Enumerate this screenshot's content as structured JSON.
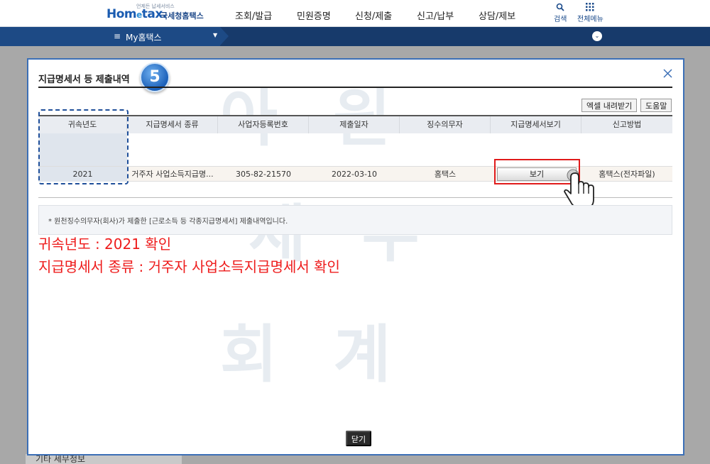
{
  "header": {
    "logo_tag": "언제든 납세서비스",
    "logo_text_home": "Hom",
    "logo_text_e": "e",
    "logo_text_tax": "tax.",
    "logo_org": "국세청홈택스",
    "nav": [
      "조회/발급",
      "민원증명",
      "신청/제출",
      "신고/납부",
      "상담/제보"
    ],
    "search_label": "검색",
    "all_menu_label": "전체메뉴"
  },
  "subnav": {
    "my_label": "My홈택스"
  },
  "background": {
    "left_menu_item": "기타 세무정보"
  },
  "modal": {
    "title": "지급명세서 등 제출내역",
    "step_number": "5",
    "excel_button": "엑셀 내려받기",
    "help_button": "도움말",
    "columns": [
      "귀속년도",
      "지급명세서 종류",
      "사업자등록번호",
      "제출일자",
      "징수의무자",
      "지급명세서보기",
      "신고방법"
    ],
    "row": {
      "year": "2021",
      "type": "거주자 사업소득지급명...",
      "business_no": "305-82-21570",
      "submit_date": "2022-03-10",
      "payer": "홈택스",
      "view_button": "보기",
      "method": "홈택스(전자파일)"
    },
    "notice": "* 원천징수의무자(회사)가 제출한 [근로소득 등 각종지급명세서] 제출내역입니다.",
    "close_button": "닫기"
  },
  "annotations": {
    "line1": "귀속년도 : 2021  확인",
    "line2": "지급명세서 종류 : 거주자 사업소득지급명세서  확인"
  },
  "watermark": [
    "아 원",
    "세 무",
    "회 계"
  ],
  "colors": {
    "brand_blue": "#1a5bb0",
    "subnav_navy": "#173a6b",
    "annotation_red": "#ee1c1c",
    "highlight_dash": "#1f4f9a"
  },
  "icons": {
    "search": "search-icon",
    "all_menu": "grid-icon",
    "close": "close-icon",
    "hamburger": "hamburger-icon",
    "cursor": "hand-pointer-icon"
  }
}
